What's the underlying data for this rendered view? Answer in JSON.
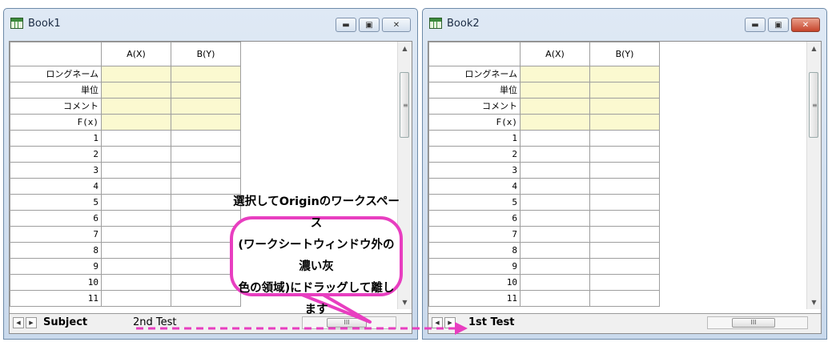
{
  "book1": {
    "title": "Book1",
    "columns": [
      "A(X)",
      "B(Y)"
    ],
    "label_rows": [
      "ロングネーム",
      "単位",
      "コメント",
      "F(x)"
    ],
    "data_rows": [
      "1",
      "2",
      "3",
      "4",
      "5",
      "6",
      "7",
      "8",
      "9",
      "10",
      "11"
    ],
    "tabs": [
      "Subject",
      "2nd Test"
    ],
    "scroll_thumb_label": "III"
  },
  "book2": {
    "title": "Book2",
    "columns": [
      "A(X)",
      "B(Y)"
    ],
    "label_rows": [
      "ロングネーム",
      "単位",
      "コメント",
      "F(x)"
    ],
    "data_rows": [
      "1",
      "2",
      "3",
      "4",
      "5",
      "6",
      "7",
      "8",
      "9",
      "10",
      "11"
    ],
    "tabs": [
      "1st Test"
    ],
    "scroll_thumb_label": "III"
  },
  "callout": {
    "text": "選択してOriginのワークスペース\n(ワークシートウィンドウ外の濃い灰\n色の領域)にドラッグして離します"
  },
  "colors": {
    "accent": "#e83ec0",
    "label_cell": "#fbf9d0",
    "close_button": "#c6452c"
  }
}
